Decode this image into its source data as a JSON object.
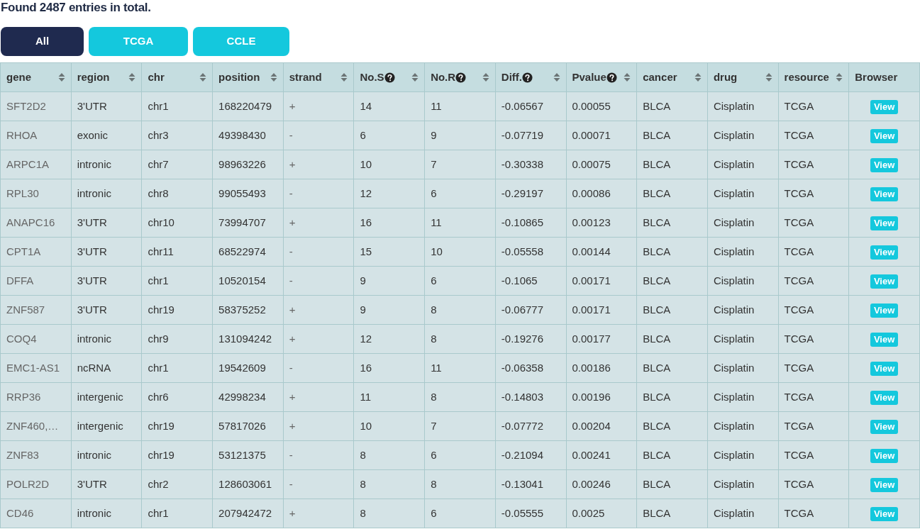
{
  "summary": "Found 2487 entries in total.",
  "filters": [
    {
      "label": "All",
      "selected": true
    },
    {
      "label": "TCGA",
      "selected": false
    },
    {
      "label": "CCLE",
      "selected": false
    }
  ],
  "table": {
    "columns": [
      {
        "label": "gene",
        "help": false,
        "sortable": true
      },
      {
        "label": "region",
        "help": false,
        "sortable": true
      },
      {
        "label": "chr",
        "help": false,
        "sortable": true
      },
      {
        "label": "position",
        "help": false,
        "sortable": true
      },
      {
        "label": "strand",
        "help": false,
        "sortable": true
      },
      {
        "label": "No.S",
        "help": true,
        "sortable": true
      },
      {
        "label": "No.R",
        "help": true,
        "sortable": true
      },
      {
        "label": "Diff.",
        "help": true,
        "sortable": true
      },
      {
        "label": "Pvalue",
        "help": true,
        "sortable": true
      },
      {
        "label": "cancer",
        "help": false,
        "sortable": true
      },
      {
        "label": "drug",
        "help": false,
        "sortable": true
      },
      {
        "label": "resource",
        "help": false,
        "sortable": true
      },
      {
        "label": "Browser",
        "help": false,
        "sortable": false
      }
    ],
    "rows": [
      {
        "cells": [
          "SFT2D2",
          "3'UTR",
          "chr1",
          "168220479",
          "+",
          "14",
          "11",
          "-0.06567",
          "0.00055",
          "BLCA",
          "Cisplatin",
          "TCGA"
        ],
        "action": "View"
      },
      {
        "cells": [
          "RHOA",
          "exonic",
          "chr3",
          "49398430",
          "-",
          "6",
          "9",
          "-0.07719",
          "0.00071",
          "BLCA",
          "Cisplatin",
          "TCGA"
        ],
        "action": "View"
      },
      {
        "cells": [
          "ARPC1A",
          "intronic",
          "chr7",
          "98963226",
          "+",
          "10",
          "7",
          "-0.30338",
          "0.00075",
          "BLCA",
          "Cisplatin",
          "TCGA"
        ],
        "action": "View"
      },
      {
        "cells": [
          "RPL30",
          "intronic",
          "chr8",
          "99055493",
          "-",
          "12",
          "6",
          "-0.29197",
          "0.00086",
          "BLCA",
          "Cisplatin",
          "TCGA"
        ],
        "action": "View"
      },
      {
        "cells": [
          "ANAPC16",
          "3'UTR",
          "chr10",
          "73994707",
          "+",
          "16",
          "11",
          "-0.10865",
          "0.00123",
          "BLCA",
          "Cisplatin",
          "TCGA"
        ],
        "action": "View"
      },
      {
        "cells": [
          "CPT1A",
          "3'UTR",
          "chr11",
          "68522974",
          "-",
          "15",
          "10",
          "-0.05558",
          "0.00144",
          "BLCA",
          "Cisplatin",
          "TCGA"
        ],
        "action": "View"
      },
      {
        "cells": [
          "DFFA",
          "3'UTR",
          "chr1",
          "10520154",
          "-",
          "9",
          "6",
          "-0.1065",
          "0.00171",
          "BLCA",
          "Cisplatin",
          "TCGA"
        ],
        "action": "View"
      },
      {
        "cells": [
          "ZNF587",
          "3'UTR",
          "chr19",
          "58375252",
          "+",
          "9",
          "8",
          "-0.06777",
          "0.00171",
          "BLCA",
          "Cisplatin",
          "TCGA"
        ],
        "action": "View"
      },
      {
        "cells": [
          "COQ4",
          "intronic",
          "chr9",
          "131094242",
          "+",
          "12",
          "8",
          "-0.19276",
          "0.00177",
          "BLCA",
          "Cisplatin",
          "TCGA"
        ],
        "action": "View"
      },
      {
        "cells": [
          "EMC1-AS1",
          "ncRNA",
          "chr1",
          "19542609",
          "-",
          "16",
          "11",
          "-0.06358",
          "0.00186",
          "BLCA",
          "Cisplatin",
          "TCGA"
        ],
        "action": "View"
      },
      {
        "cells": [
          "RRP36",
          "intergenic",
          "chr6",
          "42998234",
          "+",
          "11",
          "8",
          "-0.14803",
          "0.00196",
          "BLCA",
          "Cisplatin",
          "TCGA"
        ],
        "action": "View"
      },
      {
        "cells": [
          "ZNF460,…",
          "intergenic",
          "chr19",
          "57817026",
          "+",
          "10",
          "7",
          "-0.07772",
          "0.00204",
          "BLCA",
          "Cisplatin",
          "TCGA"
        ],
        "action": "View"
      },
      {
        "cells": [
          "ZNF83",
          "intronic",
          "chr19",
          "53121375",
          "-",
          "8",
          "6",
          "-0.21094",
          "0.00241",
          "BLCA",
          "Cisplatin",
          "TCGA"
        ],
        "action": "View"
      },
      {
        "cells": [
          "POLR2D",
          "3'UTR",
          "chr2",
          "128603061",
          "-",
          "8",
          "8",
          "-0.13041",
          "0.00246",
          "BLCA",
          "Cisplatin",
          "TCGA"
        ],
        "action": "View"
      },
      {
        "cells": [
          "CD46",
          "intronic",
          "chr1",
          "207942472",
          "+",
          "8",
          "6",
          "-0.05555",
          "0.0025",
          "BLCA",
          "Cisplatin",
          "TCGA"
        ],
        "action": "View"
      }
    ]
  }
}
